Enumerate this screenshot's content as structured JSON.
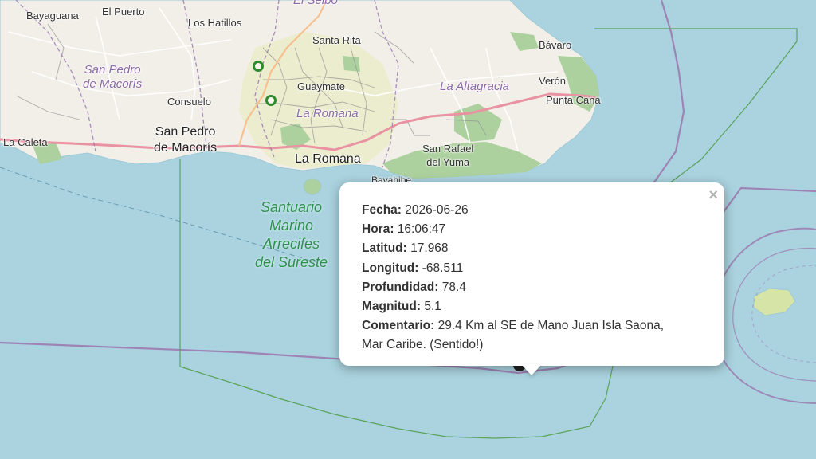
{
  "map": {
    "labels": {
      "bayaguana": "Bayaguana",
      "el_puerto": "El Puerto",
      "el_seibo": "El Seibo",
      "los_hatillos": "Los Hatillos",
      "santa_rita": "Santa Rita",
      "bavaro": "Bávaro",
      "san_pedro_region_1": "San Pedro",
      "san_pedro_region_2": "de Macorís",
      "guaymate": "Guaymate",
      "la_altagracia": "La Altagracia",
      "veron": "Verón",
      "consuelo": "Consuelo",
      "la_romana_region": "La Romana",
      "punta_cana": "Punta Cana",
      "san_pedro_city_1": "San Pedro",
      "san_pedro_city_2": "de Macorís",
      "la_caleta": "La Caleta",
      "la_romana_city": "La Romana",
      "san_rafael_1": "San Rafael",
      "san_rafael_2": "del Yuma",
      "bayahibe": "Bayahibe",
      "santuario_1": "Santuario",
      "santuario_2": "Marino",
      "santuario_3": "Arrecifes",
      "santuario_4": "del Sureste"
    },
    "colors": {
      "sea": "#aad3df",
      "land": "#f2efe9",
      "park": "#c8dfa8",
      "forest": "#add19e",
      "road_major": "#e892a2",
      "boundary": "#9b7bb0",
      "marker": "#2e8b2e"
    },
    "markers": [
      {
        "name": "seismic-station-1"
      },
      {
        "name": "seismic-station-2"
      },
      {
        "name": "earthquake-epicenter"
      }
    ]
  },
  "popup": {
    "close_icon": "×",
    "rows": [
      {
        "key": "Fecha:",
        "value": "2026-06-26"
      },
      {
        "key": "Hora:",
        "value": "16:06:47"
      },
      {
        "key": "Latitud:",
        "value": "17.968"
      },
      {
        "key": "Longitud:",
        "value": "-68.511"
      },
      {
        "key": "Profundidad:",
        "value": "78.4"
      },
      {
        "key": "Magnitud:",
        "value": "5.1"
      },
      {
        "key": "Comentario:",
        "value": "29.4 Km al SE de Mano Juan Isla Saona,"
      }
    ],
    "comment_line2": "Mar Caribe. (Sentido!)"
  }
}
